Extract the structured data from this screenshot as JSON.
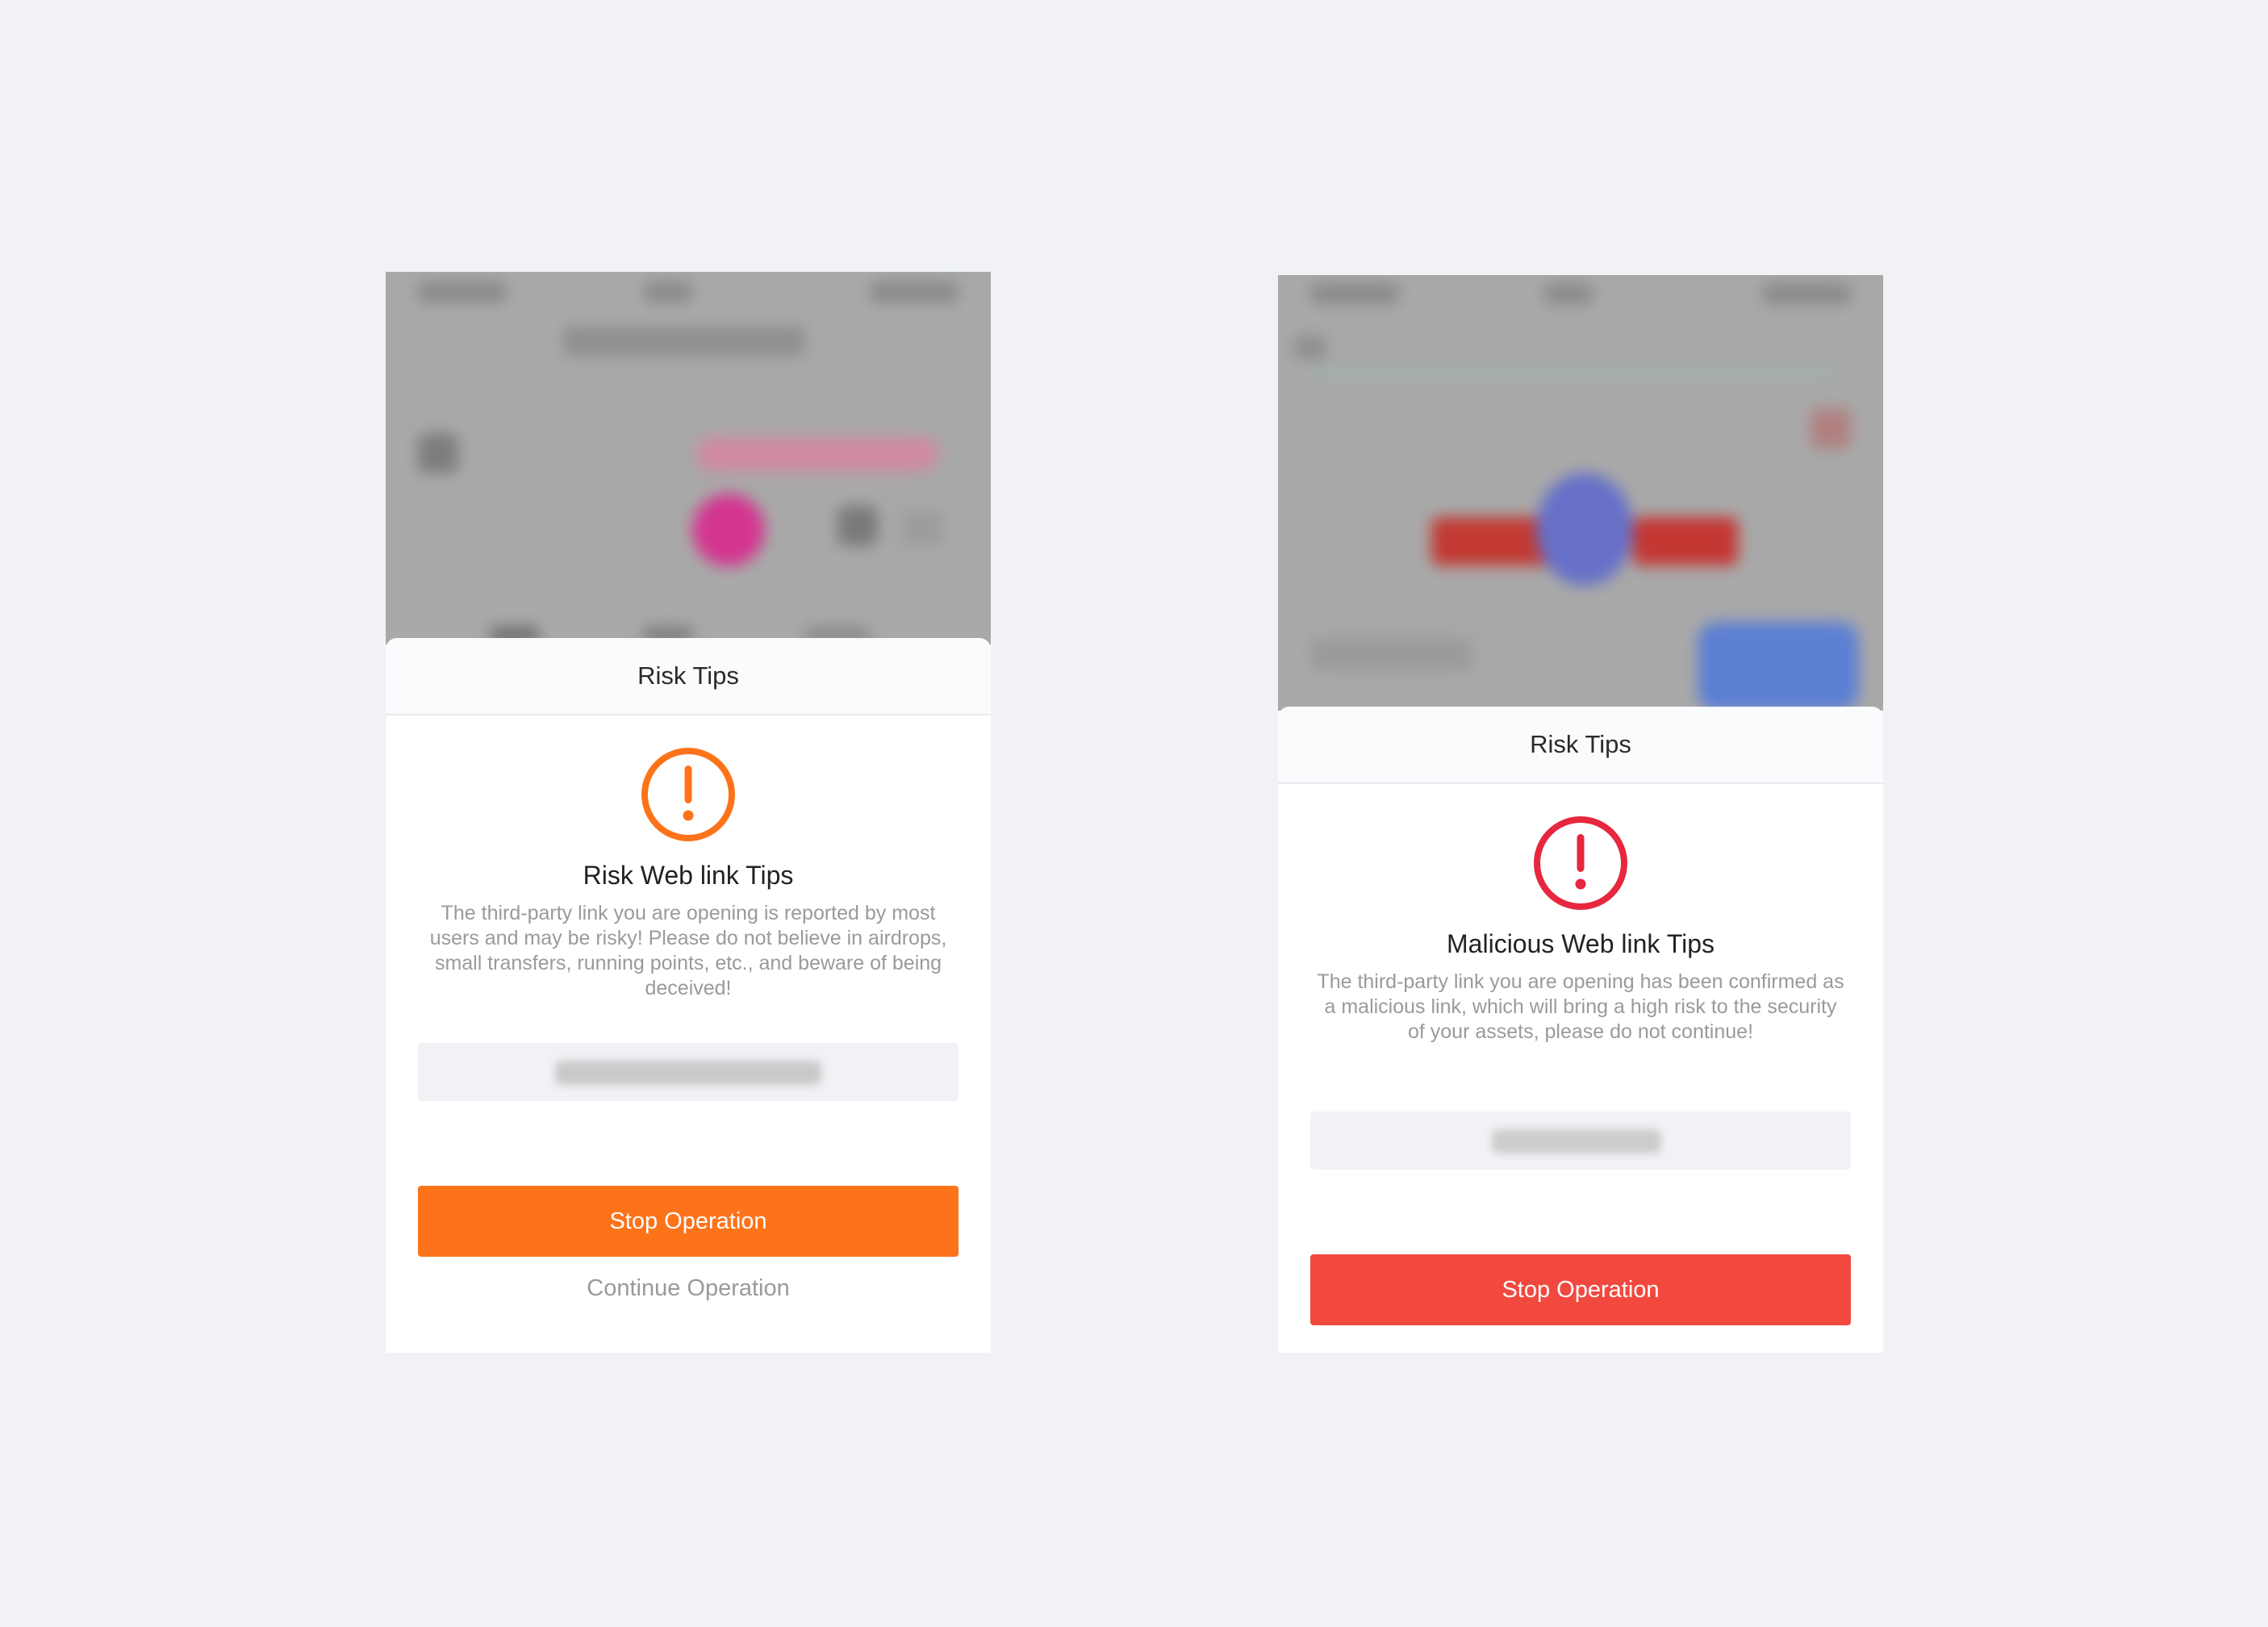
{
  "colors": {
    "page_background": "#f0f2f5",
    "risk_accent": "#fd731a",
    "malicious_accent": "#e6273e",
    "malicious_button": "#f2493f"
  },
  "left_dialog": {
    "header_title": "Risk Tips",
    "icon": "exclamation-circle-icon",
    "icon_color": "#fd731a",
    "title": "Risk Web link Tips",
    "description": "The third-party link you are opening is reported by most users and may be risky! Please do not believe in airdrops, small transfers, running points, etc., and beware of being deceived!",
    "stop_button_label": "Stop Operation",
    "continue_label": "Continue Operation"
  },
  "right_dialog": {
    "header_title": "Risk Tips",
    "icon": "exclamation-circle-icon",
    "icon_color": "#e6273e",
    "title": "Malicious Web link Tips",
    "description": "The third-party link you are opening has been confirmed as a malicious link, which will bring a high risk to the security of your assets, please do not continue!",
    "stop_button_label": "Stop Operation"
  }
}
